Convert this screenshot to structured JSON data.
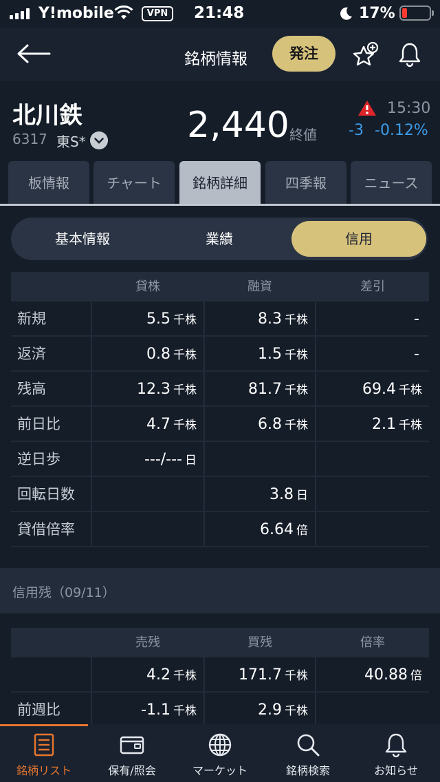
{
  "status_bar": {
    "carrier": "Y!mobile",
    "vpn": "VPN",
    "time": "21:48",
    "battery": "17%",
    "battery_level": 0.17
  },
  "nav": {
    "title": "銘柄情報",
    "order_button": "発注",
    "icons": [
      "back-arrow-icon",
      "star-add-icon",
      "bell-icon"
    ]
  },
  "stock": {
    "name": "北川鉄",
    "code": "6317",
    "market": "東S*",
    "price": "2,440",
    "price_label": "終値",
    "time": "15:30",
    "change": "-3",
    "change_pct": "-0.12%",
    "change_color": "#3d9ce8"
  },
  "tabs": [
    "板情報",
    "チャート",
    "銘柄詳細",
    "四季報",
    "ニュース"
  ],
  "segments": [
    "基本情報",
    "業績",
    "信用"
  ],
  "credit_table": {
    "headers": [
      "",
      "貸株",
      "融資",
      "差引"
    ],
    "rows": [
      {
        "label": "新規",
        "c1": "5.5",
        "u1": "千株",
        "c2": "8.3",
        "u2": "千株",
        "c3": "-",
        "u3": ""
      },
      {
        "label": "返済",
        "c1": "0.8",
        "u1": "千株",
        "c2": "1.5",
        "u2": "千株",
        "c3": "-",
        "u3": ""
      },
      {
        "label": "残高",
        "c1": "12.3",
        "u1": "千株",
        "c2": "81.7",
        "u2": "千株",
        "c3": "69.4",
        "u3": "千株"
      },
      {
        "label": "前日比",
        "c1": "4.7",
        "u1": "千株",
        "c2": "6.8",
        "u2": "千株",
        "c3": "2.1",
        "u3": "千株"
      },
      {
        "label": "逆日歩",
        "c1": "---/---",
        "u1": "日",
        "c2": "",
        "u2": "",
        "c3": "",
        "u3": ""
      },
      {
        "label": "回転日数",
        "c1": "",
        "u1": "",
        "c2": "3.8",
        "u2": "日",
        "c3": "",
        "u3": ""
      },
      {
        "label": "貸借倍率",
        "c1": "",
        "u1": "",
        "c2": "6.64",
        "u2": "倍",
        "c3": "",
        "u3": ""
      }
    ]
  },
  "margin_section": {
    "title": "信用残（09/11）",
    "headers": [
      "",
      "売残",
      "買残",
      "倍率"
    ],
    "rows": [
      {
        "label": "",
        "c1": "4.2",
        "u1": "千株",
        "c2": "171.7",
        "u2": "千株",
        "c3": "40.88",
        "u3": "倍"
      },
      {
        "label": "前週比",
        "c1": "-1.1",
        "u1": "千株",
        "c2": "2.9",
        "u2": "千株",
        "c3": "",
        "u3": ""
      }
    ]
  },
  "bottom_tabs": [
    {
      "label": "銘柄リスト",
      "icon": "list-icon"
    },
    {
      "label": "保有/照会",
      "icon": "wallet-icon"
    },
    {
      "label": "マーケット",
      "icon": "globe-icon"
    },
    {
      "label": "銘柄検索",
      "icon": "search-icon"
    },
    {
      "label": "お知らせ",
      "icon": "bell-icon"
    }
  ],
  "colors": {
    "accent_gold": "#d7c27c",
    "active_tab_orange": "#e8762d",
    "background": "#151d29"
  }
}
